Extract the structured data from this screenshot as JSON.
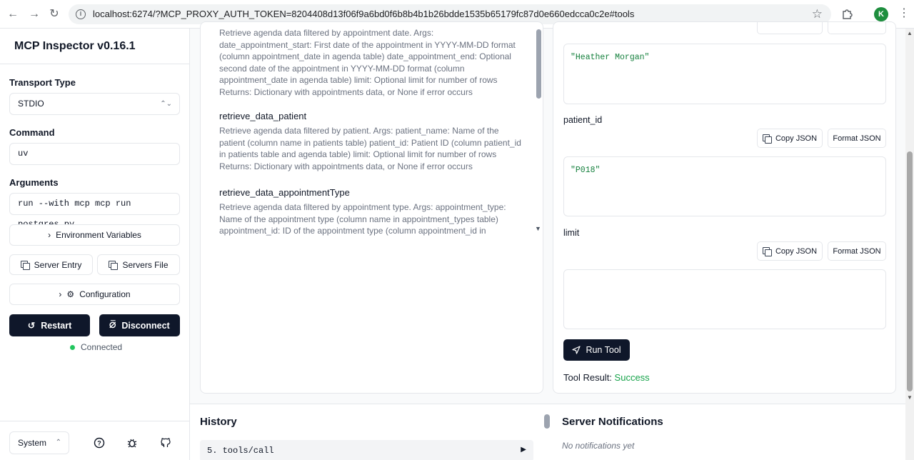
{
  "browser": {
    "url": "localhost:6274/?MCP_PROXY_AUTH_TOKEN=8204408d13f06f9a6bd0f6b8b4b1b26bdde1535b65179fc87d0e660edcca0c2e#tools",
    "profile_initial": "K"
  },
  "sidebar": {
    "title": "MCP Inspector v0.16.1",
    "transport_label": "Transport Type",
    "transport_value": "STDIO",
    "command_label": "Command",
    "command_value": "uv",
    "arguments_label": "Arguments",
    "arguments_value": "run --with mcp mcp run postgres.py",
    "env_vars_label": "Environment Variables",
    "server_entry_label": "Server Entry",
    "servers_file_label": "Servers File",
    "configuration_label": "Configuration",
    "restart_label": "Restart",
    "disconnect_label": "Disconnect",
    "status_text": "Connected",
    "theme_value": "System"
  },
  "tools": [
    {
      "name": "",
      "description": "Retrieve agenda data filtered by appointment date. Args: date_appointment_start: First date of the appointment in YYYY-MM-DD format (column appointment_date in agenda table) date_appointment_end: Optional second date of the appointment in YYYY-MM-DD format (column appointment_date in agenda table) limit: Optional limit for number of rows Returns: Dictionary with appointments data, or None if error occurs"
    },
    {
      "name": "retrieve_data_patient",
      "description": "Retrieve agenda data filtered by patient. Args: patient_name: Name of the patient (column name in patients table) patient_id: Patient ID (column patient_id in patients table and agenda table) limit: Optional limit for number of rows Returns: Dictionary with appointments data, or None if error occurs"
    },
    {
      "name": "retrieve_data_appointmentType",
      "description": "Retrieve agenda data filtered by appointment type. Args: appointment_type: Name of the appointment type (column name in appointment_types table) appointment_id: ID of the appointment type (column appointment_id in"
    }
  ],
  "form": {
    "patient_name_value": "\"Heather Morgan\"",
    "patient_id_label": "patient_id",
    "patient_id_value": "\"P018\"",
    "limit_label": "limit",
    "limit_value": "",
    "copy_json_label": "Copy JSON",
    "format_json_label": "Format JSON",
    "run_label": "Run Tool",
    "result_label": "Tool Result:",
    "result_status": "Success"
  },
  "history": {
    "title": "History",
    "entries": [
      {
        "label": "5. tools/call"
      }
    ]
  },
  "notifications": {
    "title": "Server Notifications",
    "empty_text": "No notifications yet"
  },
  "colors": {
    "primary_dark": "#0f172a",
    "success": "#16a34a",
    "json_text": "#15803d"
  }
}
